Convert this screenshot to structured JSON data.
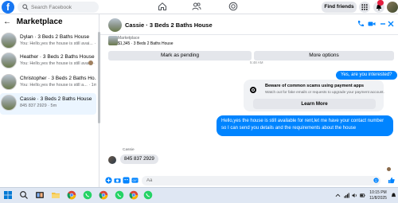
{
  "topbar": {
    "logo": "f",
    "search_placeholder": "Search Facebook",
    "find_friends": "Find friends",
    "icons": [
      "home-icon",
      "friends-icon",
      "groups-icon",
      "apps-icon",
      "messenger-icon",
      "notifications-icon"
    ]
  },
  "sidebar": {
    "title": "Marketplace",
    "back_arrow": "←",
    "threads": [
      {
        "title": "Dylan · 3 Beds 2 Baths House",
        "sub": "You: Hello,yes the house is still avai... · 1m",
        "active": false
      },
      {
        "title": "Heather · 3 Beds 2 Baths House",
        "sub": "You: Hello,yes the house is still ava... · 1m",
        "active": false
      },
      {
        "title": "Christopher · 3 Beds 2 Baths Ho...",
        "sub": "You: Hello,yes the house is still a... · 1m",
        "active": false
      },
      {
        "title": "Cassie · 3 Beds 2 Baths House",
        "sub": "845 837 2929 · 5m",
        "active": true
      }
    ]
  },
  "chat": {
    "header_name": "Cassie · 3 Beds 2 Baths House",
    "listing_label": "Marketplace",
    "listing_price": "$1,345 · 3 Beds 2 Baths House",
    "mark_pending": "Mark as pending",
    "more_options": "More options",
    "time_stub": "5:48 AM",
    "msg_out_1": "Yes, are you interested?",
    "warning_title": "Beware of common scams using payment apps",
    "warning_desc": "Watch out for fake emails or requests to upgrade your payment account.",
    "learn_more": "Learn More",
    "msg_out_2": "Hello,yes the house is still available for rent,let me have your contact number so I can send you details and the requirements about the house",
    "in_sender": "Cassie",
    "msg_in": "845 837 2929",
    "composer_placeholder": "Aa"
  },
  "taskbar": {
    "time": "10:15 PM",
    "date": "11/8/2025",
    "apps": [
      "start-icon",
      "search-icon",
      "task-view-icon",
      "file-explorer-icon",
      "chrome-icon",
      "whatsapp-icon",
      "chrome-icon",
      "whatsapp-icon",
      "chrome-icon",
      "whatsapp-icon"
    ]
  },
  "colors": {
    "accent": "#0084ff",
    "brand": "#1877f2",
    "active_thread": "#ebf5ff"
  }
}
